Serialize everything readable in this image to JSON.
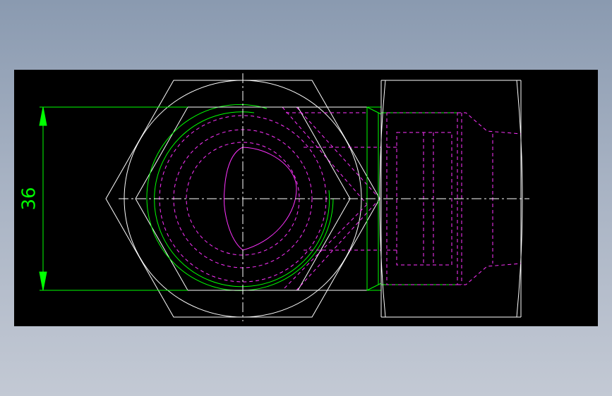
{
  "colors": {
    "outline": "#ffffff",
    "dimension": "#00ff00",
    "hidden": "#ff33ff",
    "centerline": "#ffffff",
    "canvas_bg": "#000000"
  },
  "dimension": {
    "value": "36"
  }
}
